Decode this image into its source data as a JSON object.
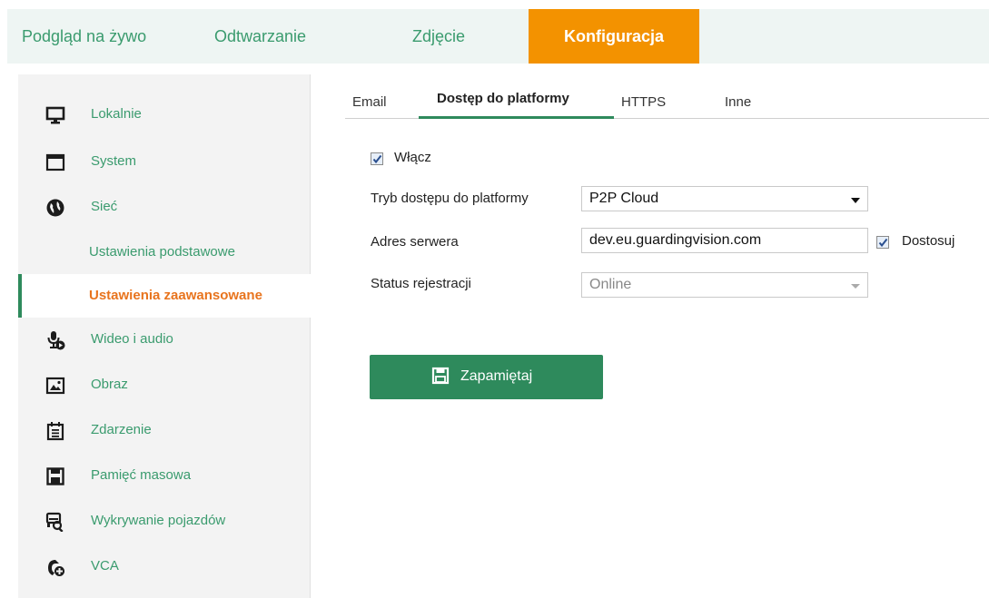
{
  "topnav": {
    "tabs": [
      {
        "label": "Podgląd na żywo"
      },
      {
        "label": "Odtwarzanie"
      },
      {
        "label": "Zdjęcie"
      },
      {
        "label": "Konfiguracja",
        "active": true
      }
    ]
  },
  "sidebar": {
    "items": [
      {
        "label": "Lokalnie",
        "icon": "monitor-icon"
      },
      {
        "label": "System",
        "icon": "window-icon"
      },
      {
        "label": "Sieć",
        "icon": "globe-icon"
      },
      {
        "label": "Ustawienia podstawowe"
      },
      {
        "label": "Ustawienia zaawansowane",
        "active": true
      },
      {
        "label": "Wideo i audio",
        "icon": "microphone-icon"
      },
      {
        "label": "Obraz",
        "icon": "image-icon"
      },
      {
        "label": "Zdarzenie",
        "icon": "calendar-icon"
      },
      {
        "label": "Pamięć masowa",
        "icon": "floppy-icon"
      },
      {
        "label": "Wykrywanie pojazdów",
        "icon": "vehicle-search-icon"
      },
      {
        "label": "VCA",
        "icon": "vca-icon"
      }
    ]
  },
  "subtabs": [
    {
      "label": "Email"
    },
    {
      "label": "Dostęp do platformy",
      "active": true
    },
    {
      "label": "HTTPS"
    },
    {
      "label": "Inne"
    }
  ],
  "form": {
    "enable": {
      "label": "Włącz",
      "checked": true
    },
    "mode": {
      "label": "Tryb dostępu do platformy",
      "value": "P2P Cloud"
    },
    "server": {
      "label": "Adres serwera",
      "value": "dev.eu.guardingvision.com",
      "custom_label": "Dostosuj",
      "custom_checked": true
    },
    "status": {
      "label": "Status rejestracji",
      "value": "Online"
    },
    "save_label": "Zapamiętaj"
  },
  "colors": {
    "accent_green": "#2e8a5c",
    "active_orange": "#f39200",
    "text_green": "#3a9b6e",
    "active_item_orange": "#e8741e"
  }
}
